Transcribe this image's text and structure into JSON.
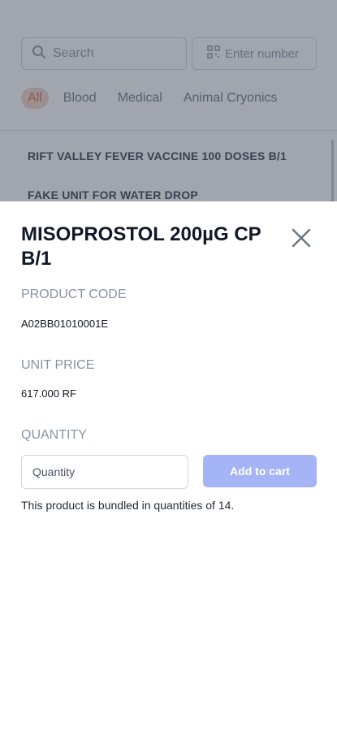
{
  "background": {
    "search_placeholder": "Search",
    "number_placeholder": "Enter number",
    "categories": [
      "All",
      "Blood",
      "Medical",
      "Animal Cryonics"
    ],
    "list_items": [
      "RIFT VALLEY FEVER VACCINE 100 DOSES B/1",
      "FAKE UNIT FOR WATER DROP"
    ]
  },
  "modal": {
    "title": "MISOPROSTOL 200µG CP B/1",
    "close_icon": "close-icon",
    "product_code_label": "PRODUCT CODE",
    "product_code_value": "A02BB01010001E",
    "unit_price_label": "UNIT PRICE",
    "unit_price_value": "617.000 RF",
    "quantity_label": "QUANTITY",
    "quantity_placeholder": "Quantity",
    "add_to_cart_label": "Add to cart",
    "bundle_note": "This product is bundled in quantities of 14."
  },
  "colors": {
    "primary_disabled": "#a5b4f6",
    "overlay": "#1e293b",
    "active_category": "#e07a5f"
  }
}
